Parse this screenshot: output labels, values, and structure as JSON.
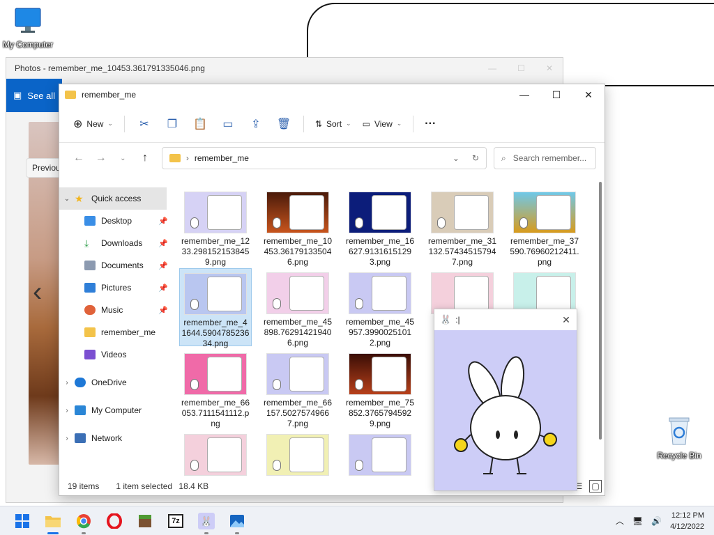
{
  "desktop": {
    "icons": [
      {
        "label": "My Computer"
      },
      {
        "label": "Recycle Bin"
      }
    ]
  },
  "photos": {
    "title": "Photos - remember_me_10453.361791335046.png",
    "see_all": "See all",
    "previous": "Previous"
  },
  "explorer": {
    "title": "remember_me",
    "toolbar": {
      "new": "New",
      "sort": "Sort",
      "view": "View",
      "more": "···"
    },
    "address": "remember_me",
    "search_placeholder": "Search remember...",
    "nav": {
      "quick_access": "Quick access",
      "desktop": "Desktop",
      "downloads": "Downloads",
      "documents": "Documents",
      "pictures": "Pictures",
      "music": "Music",
      "remember_me": "remember_me",
      "videos": "Videos",
      "onedrive": "OneDrive",
      "my_computer": "My Computer",
      "network": "Network"
    },
    "files": [
      {
        "name": "remember_me_1233.2981521538459.png"
      },
      {
        "name": "remember_me_10453.361791335046.png"
      },
      {
        "name": "remember_me_16627.91316151293.png"
      },
      {
        "name": "remember_me_31132.574345157947.png"
      },
      {
        "name": "remember_me_37590.76960212411.png"
      },
      {
        "name": "remember_me_41644.590478523634.png"
      },
      {
        "name": "remember_me_45898.762914219406.png"
      },
      {
        "name": "remember_me_45957.39900251012.png"
      },
      {
        "name": "remember_me_66053.7111541112.png"
      },
      {
        "name": "remember_me_66157.50275749667.png"
      },
      {
        "name": "remember_me_75852.37657945929.png"
      }
    ],
    "status": {
      "items": "19 items",
      "selected": "1 item selected",
      "size": "18.4 KB"
    }
  },
  "bunny_window": {
    "title": ":|"
  },
  "taskbar": {
    "time": "12:12 PM",
    "date": "4/12/2022"
  },
  "colors": {
    "accent": "#1a73e8",
    "selection": "#cce4f7",
    "bunny_bg": "#cdcdf7",
    "photos_band": "#0a64c8"
  }
}
